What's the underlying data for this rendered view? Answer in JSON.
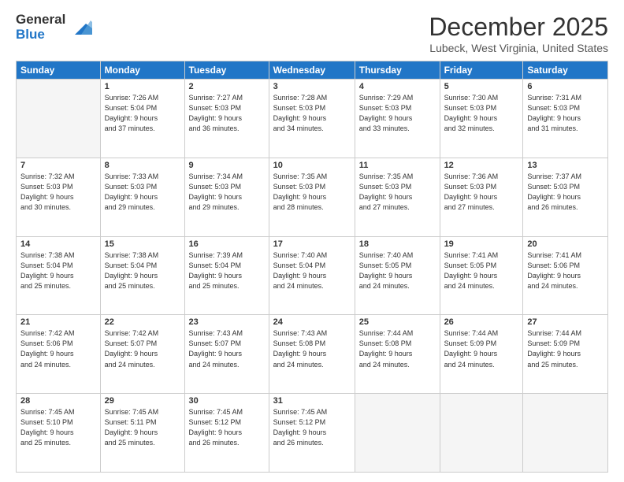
{
  "header": {
    "logo_line1": "General",
    "logo_line2": "Blue",
    "month": "December 2025",
    "location": "Lubeck, West Virginia, United States"
  },
  "weekdays": [
    "Sunday",
    "Monday",
    "Tuesday",
    "Wednesday",
    "Thursday",
    "Friday",
    "Saturday"
  ],
  "weeks": [
    [
      {
        "day": "",
        "info": ""
      },
      {
        "day": "1",
        "info": "Sunrise: 7:26 AM\nSunset: 5:04 PM\nDaylight: 9 hours\nand 37 minutes."
      },
      {
        "day": "2",
        "info": "Sunrise: 7:27 AM\nSunset: 5:03 PM\nDaylight: 9 hours\nand 36 minutes."
      },
      {
        "day": "3",
        "info": "Sunrise: 7:28 AM\nSunset: 5:03 PM\nDaylight: 9 hours\nand 34 minutes."
      },
      {
        "day": "4",
        "info": "Sunrise: 7:29 AM\nSunset: 5:03 PM\nDaylight: 9 hours\nand 33 minutes."
      },
      {
        "day": "5",
        "info": "Sunrise: 7:30 AM\nSunset: 5:03 PM\nDaylight: 9 hours\nand 32 minutes."
      },
      {
        "day": "6",
        "info": "Sunrise: 7:31 AM\nSunset: 5:03 PM\nDaylight: 9 hours\nand 31 minutes."
      }
    ],
    [
      {
        "day": "7",
        "info": "Sunrise: 7:32 AM\nSunset: 5:03 PM\nDaylight: 9 hours\nand 30 minutes."
      },
      {
        "day": "8",
        "info": "Sunrise: 7:33 AM\nSunset: 5:03 PM\nDaylight: 9 hours\nand 29 minutes."
      },
      {
        "day": "9",
        "info": "Sunrise: 7:34 AM\nSunset: 5:03 PM\nDaylight: 9 hours\nand 29 minutes."
      },
      {
        "day": "10",
        "info": "Sunrise: 7:35 AM\nSunset: 5:03 PM\nDaylight: 9 hours\nand 28 minutes."
      },
      {
        "day": "11",
        "info": "Sunrise: 7:35 AM\nSunset: 5:03 PM\nDaylight: 9 hours\nand 27 minutes."
      },
      {
        "day": "12",
        "info": "Sunrise: 7:36 AM\nSunset: 5:03 PM\nDaylight: 9 hours\nand 27 minutes."
      },
      {
        "day": "13",
        "info": "Sunrise: 7:37 AM\nSunset: 5:03 PM\nDaylight: 9 hours\nand 26 minutes."
      }
    ],
    [
      {
        "day": "14",
        "info": "Sunrise: 7:38 AM\nSunset: 5:04 PM\nDaylight: 9 hours\nand 25 minutes."
      },
      {
        "day": "15",
        "info": "Sunrise: 7:38 AM\nSunset: 5:04 PM\nDaylight: 9 hours\nand 25 minutes."
      },
      {
        "day": "16",
        "info": "Sunrise: 7:39 AM\nSunset: 5:04 PM\nDaylight: 9 hours\nand 25 minutes."
      },
      {
        "day": "17",
        "info": "Sunrise: 7:40 AM\nSunset: 5:04 PM\nDaylight: 9 hours\nand 24 minutes."
      },
      {
        "day": "18",
        "info": "Sunrise: 7:40 AM\nSunset: 5:05 PM\nDaylight: 9 hours\nand 24 minutes."
      },
      {
        "day": "19",
        "info": "Sunrise: 7:41 AM\nSunset: 5:05 PM\nDaylight: 9 hours\nand 24 minutes."
      },
      {
        "day": "20",
        "info": "Sunrise: 7:41 AM\nSunset: 5:06 PM\nDaylight: 9 hours\nand 24 minutes."
      }
    ],
    [
      {
        "day": "21",
        "info": "Sunrise: 7:42 AM\nSunset: 5:06 PM\nDaylight: 9 hours\nand 24 minutes."
      },
      {
        "day": "22",
        "info": "Sunrise: 7:42 AM\nSunset: 5:07 PM\nDaylight: 9 hours\nand 24 minutes."
      },
      {
        "day": "23",
        "info": "Sunrise: 7:43 AM\nSunset: 5:07 PM\nDaylight: 9 hours\nand 24 minutes."
      },
      {
        "day": "24",
        "info": "Sunrise: 7:43 AM\nSunset: 5:08 PM\nDaylight: 9 hours\nand 24 minutes."
      },
      {
        "day": "25",
        "info": "Sunrise: 7:44 AM\nSunset: 5:08 PM\nDaylight: 9 hours\nand 24 minutes."
      },
      {
        "day": "26",
        "info": "Sunrise: 7:44 AM\nSunset: 5:09 PM\nDaylight: 9 hours\nand 24 minutes."
      },
      {
        "day": "27",
        "info": "Sunrise: 7:44 AM\nSunset: 5:09 PM\nDaylight: 9 hours\nand 25 minutes."
      }
    ],
    [
      {
        "day": "28",
        "info": "Sunrise: 7:45 AM\nSunset: 5:10 PM\nDaylight: 9 hours\nand 25 minutes."
      },
      {
        "day": "29",
        "info": "Sunrise: 7:45 AM\nSunset: 5:11 PM\nDaylight: 9 hours\nand 25 minutes."
      },
      {
        "day": "30",
        "info": "Sunrise: 7:45 AM\nSunset: 5:12 PM\nDaylight: 9 hours\nand 26 minutes."
      },
      {
        "day": "31",
        "info": "Sunrise: 7:45 AM\nSunset: 5:12 PM\nDaylight: 9 hours\nand 26 minutes."
      },
      {
        "day": "",
        "info": ""
      },
      {
        "day": "",
        "info": ""
      },
      {
        "day": "",
        "info": ""
      }
    ]
  ]
}
